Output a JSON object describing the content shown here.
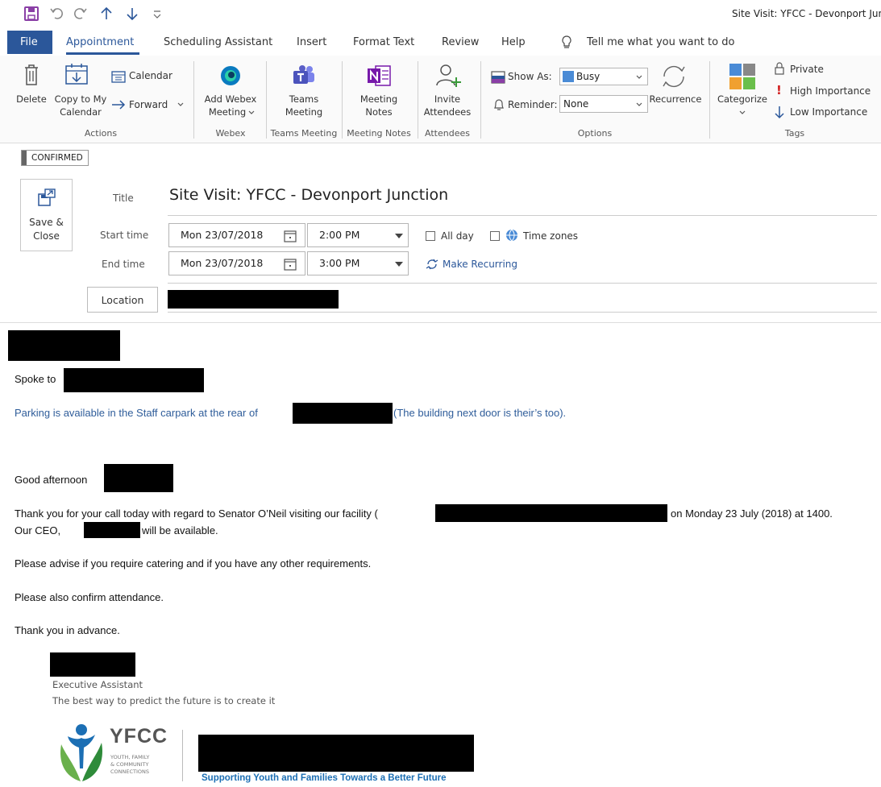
{
  "window_title": "Site Visit: YFCC - Devonport Jun",
  "tabs": [
    "File",
    "Appointment",
    "Scheduling Assistant",
    "Insert",
    "Format Text",
    "Review",
    "Help"
  ],
  "tell_me": "Tell me what you want to do",
  "ribbon": {
    "delete": "Delete",
    "copy_to_my_calendar": [
      "Copy to My",
      "Calendar"
    ],
    "calendar": "Calendar",
    "forward": "Forward",
    "actions_group": "Actions",
    "add_webex": [
      "Add Webex",
      "Meeting"
    ],
    "webex_group": "Webex",
    "teams_meeting": [
      "Teams",
      "Meeting"
    ],
    "teams_group": "Teams Meeting",
    "meeting_notes": [
      "Meeting",
      "Notes"
    ],
    "notes_group": "Meeting Notes",
    "invite_attendees": [
      "Invite",
      "Attendees"
    ],
    "attendees_group": "Attendees",
    "show_as_label": "Show As:",
    "show_as_value": "Busy",
    "reminder_label": "Reminder:",
    "reminder_value": "None",
    "recurrence": "Recurrence",
    "options_group": "Options",
    "categorize": "Categorize",
    "private": "Private",
    "high_importance": "High Importance",
    "low_importance": "Low Importance",
    "tags_group": "Tags"
  },
  "status_badge": "CONFIRMED",
  "save_close": [
    "Save &",
    "Close"
  ],
  "form": {
    "title_label": "Title",
    "title_value": "Site Visit: YFCC - Devonport Junction",
    "start_label": "Start time",
    "start_date": "Mon 23/07/2018",
    "start_time": "2:00 PM",
    "end_label": "End time",
    "end_date": "Mon 23/07/2018",
    "end_time": "3:00 PM",
    "all_day": "All day",
    "time_zones": "Time zones",
    "make_recurring": "Make Recurring",
    "location_button": "Location"
  },
  "body": {
    "spoke_to": "Spoke to",
    "parking_1": "Parking is available in the Staff carpark at the rear of",
    "parking_2": "(The building next door is their’s too).",
    "greeting": "Good afternoon",
    "para1_a": "Thank you for your call today with regard to Senator O’Neil visiting our facility (",
    "para1_b": "on Monday 23 July (2018) at 1400.",
    "para1_c": "Our CEO,",
    "para1_d": "will be available.",
    "para2": "Please advise if you require catering and if you have any other requirements.",
    "para3": "Please also confirm attendance.",
    "para4": "Thank you in advance.",
    "sig_title": "Executive Assistant",
    "sig_quote": "The best way to predict the future is to create it",
    "logo_name": "YFCC",
    "logo_sub": [
      "YOUTH, FAMILY",
      "& COMMUNITY",
      "CONNECTIONS"
    ],
    "tagline": "Supporting Youth and Families Towards a Better Future"
  },
  "colors": {
    "accent": "#2b579a",
    "purple": "#7b3fa0",
    "teams": "#5b5fc7",
    "link": "#2f5d9a"
  }
}
